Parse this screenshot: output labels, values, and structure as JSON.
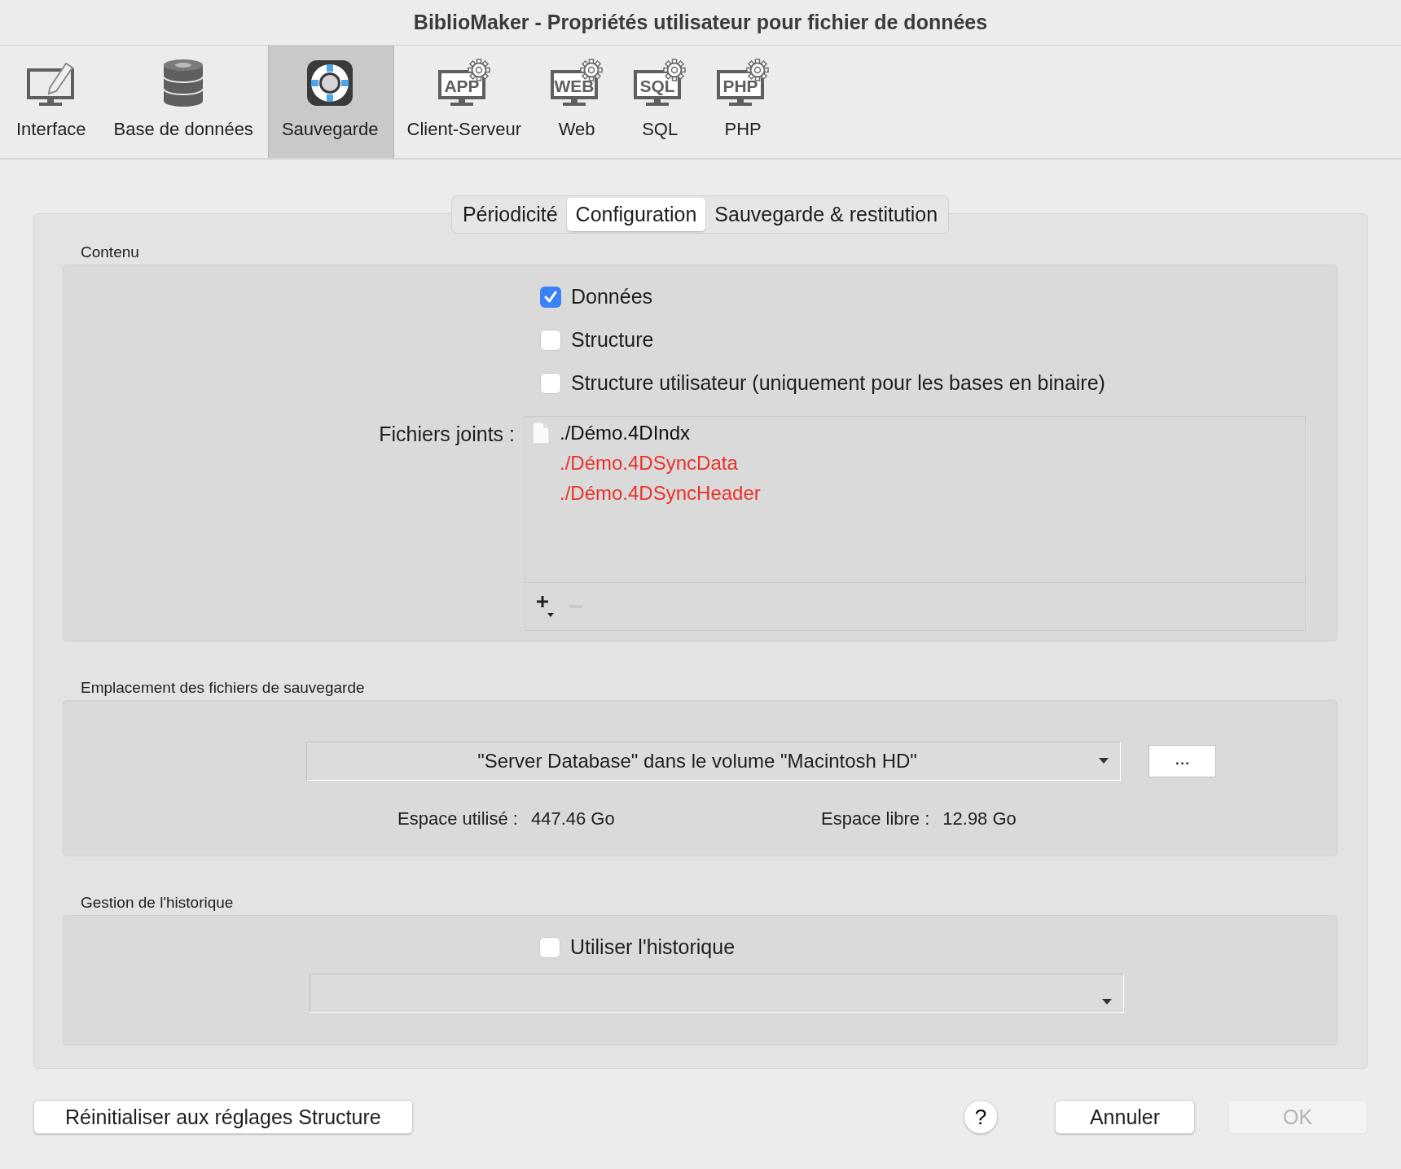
{
  "window": {
    "title": "BiblioMaker - Propriétés utilisateur pour fichier de données"
  },
  "toolbar": {
    "items": [
      {
        "label": "Interface",
        "kind": "pencil",
        "selected": false
      },
      {
        "label": "Base de données",
        "kind": "database",
        "selected": false
      },
      {
        "label": "Sauvegarde",
        "kind": "lifebuoy",
        "selected": true
      },
      {
        "label": "Client-Serveur",
        "kind": "gear",
        "icon_text": "APP",
        "selected": false
      },
      {
        "label": "Web",
        "kind": "gear",
        "icon_text": "WEB",
        "selected": false
      },
      {
        "label": "SQL",
        "kind": "gear",
        "icon_text": "SQL",
        "selected": false
      },
      {
        "label": "PHP",
        "kind": "gear",
        "icon_text": "PHP",
        "selected": false
      }
    ]
  },
  "tabs": [
    {
      "label": "Périodicité",
      "selected": false
    },
    {
      "label": "Configuration",
      "selected": true
    },
    {
      "label": "Sauvegarde & restitution",
      "selected": false
    }
  ],
  "content": {
    "title": "Contenu",
    "options": [
      {
        "label": "Données",
        "checked": true
      },
      {
        "label": "Structure",
        "checked": false
      },
      {
        "label": "Structure utilisateur (uniquement pour les bases en binaire)",
        "checked": false
      }
    ],
    "attached_label": "Fichiers joints :",
    "attached_files": [
      {
        "name": "./Démo.4DIndx",
        "missing": false
      },
      {
        "name": "./Démo.4DSyncData",
        "missing": true
      },
      {
        "name": "./Démo.4DSyncHeader",
        "missing": true
      }
    ],
    "remove_disabled": true
  },
  "location": {
    "title": "Emplacement des fichiers de sauvegarde",
    "volume": "\"Server Database\" dans le volume \"Macintosh HD\"",
    "browse": "...",
    "used_label": "Espace utilisé :",
    "used_value": "447.46 Go",
    "free_label": "Espace libre :",
    "free_value": "12.98 Go"
  },
  "history": {
    "title": "Gestion de l'historique",
    "option": {
      "label": "Utiliser l'historique",
      "checked": false
    }
  },
  "buttons": {
    "reset": {
      "label": "Réinitialiser aux réglages Structure",
      "disabled": false
    },
    "help": "?",
    "cancel": {
      "label": "Annuler",
      "disabled": false
    },
    "ok": {
      "label": "OK",
      "disabled": true
    }
  }
}
